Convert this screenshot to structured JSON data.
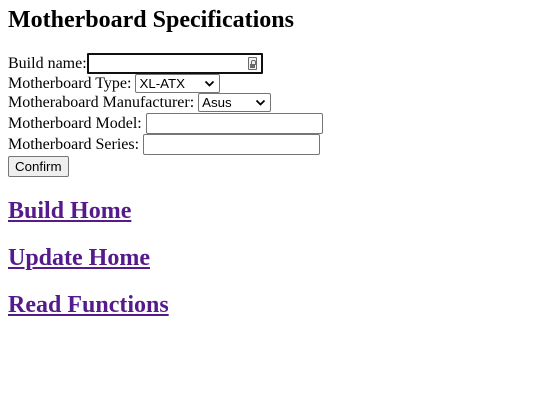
{
  "page": {
    "title": "Motherboard Specifications"
  },
  "form": {
    "build_name": {
      "label": "Build name:",
      "value": ""
    },
    "type": {
      "label": "Motherboard Type:",
      "selected": "XL-ATX"
    },
    "manufacturer": {
      "label": "Motheraboard Manufacturer:",
      "selected": "Asus"
    },
    "model": {
      "label": "Motherboard Model:",
      "value": ""
    },
    "series": {
      "label": "Motherboard Series:",
      "value": ""
    },
    "confirm_label": "Confirm"
  },
  "links": {
    "build_home": "Build Home",
    "update_home": "Update Home",
    "read_functions": "Read Functions"
  },
  "colors": {
    "link_visited": "#551a8b",
    "focus_border": "#101010",
    "control_border": "#767676",
    "button_bg": "#efefef"
  },
  "icons": {
    "build_name_field": "keyboard-lock-icon",
    "select_arrow": "chevron-down-icon"
  }
}
